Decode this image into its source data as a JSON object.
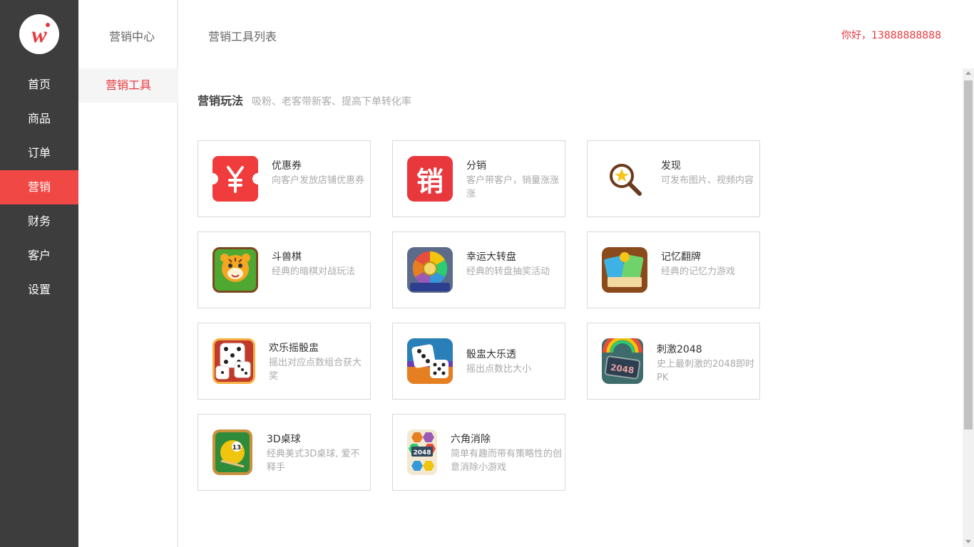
{
  "brand": {
    "logo_text": "w"
  },
  "sidebar": {
    "items": [
      {
        "label": "首页"
      },
      {
        "label": "商品"
      },
      {
        "label": "订单"
      },
      {
        "label": "营销",
        "active": true
      },
      {
        "label": "财务"
      },
      {
        "label": "客户"
      },
      {
        "label": "设置"
      }
    ]
  },
  "subnav": {
    "title": "营销中心",
    "items": [
      {
        "label": "营销工具",
        "active": true
      }
    ]
  },
  "header": {
    "page_title": "营销工具列表",
    "greeting": "你好，13888888888"
  },
  "section": {
    "title": "营销玩法",
    "description": "吸粉、老客带新客、提高下单转化率"
  },
  "tools": [
    {
      "name": "优惠券",
      "desc": "向客户发放店铺优惠券",
      "icon": "coupon-icon"
    },
    {
      "name": "分销",
      "desc": "客户带客户，销量涨涨涨",
      "icon": "distribution-icon",
      "icon_text": "销"
    },
    {
      "name": "发现",
      "desc": "可发布图片、视频内容",
      "icon": "discover-magnifier-icon"
    },
    {
      "name": "斗兽棋",
      "desc": "经典的暗棋对战玩法",
      "icon": "tiger-game-icon"
    },
    {
      "name": "幸运大转盘",
      "desc": "经典的转盘抽奖活动",
      "icon": "lucky-wheel-icon"
    },
    {
      "name": "记忆翻牌",
      "desc": "经典的记忆力游戏",
      "icon": "memory-cards-icon"
    },
    {
      "name": "欢乐摇骰盅",
      "desc": "摇出对应点数组合获大奖",
      "icon": "dice-cup-icon"
    },
    {
      "name": "骰盅大乐透",
      "desc": "摇出点数比大小",
      "icon": "dice-lotto-icon"
    },
    {
      "name": "刺激2048",
      "desc": "史上最刺激的2048即时PK",
      "icon": "game-2048-icon",
      "icon_text": "2048"
    },
    {
      "name": "3D桌球",
      "desc": "经典美式3D桌球, 爱不释手",
      "icon": "billiards-icon",
      "icon_text": "13"
    },
    {
      "name": "六角消除",
      "desc": "简单有趣而带有策略性的创意消除小游戏",
      "icon": "hexagon-eliminate-icon",
      "icon_text": "2048"
    }
  ],
  "colors": {
    "accent": "#e8383d",
    "sidebar_bg": "#3d3d3d",
    "active_nav_bg": "#f04844"
  }
}
